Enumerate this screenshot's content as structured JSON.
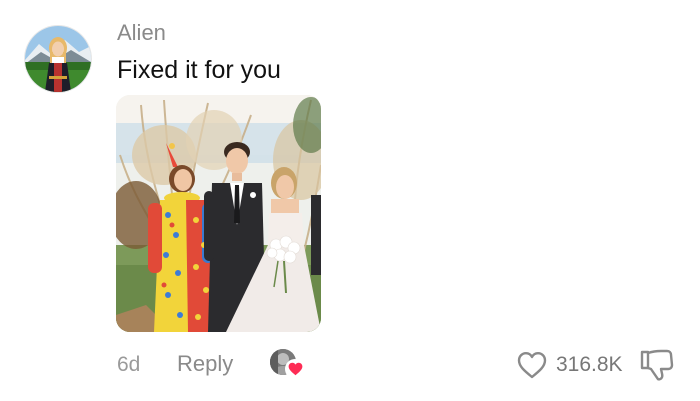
{
  "comment": {
    "username": "Alien",
    "text": "Fixed it for you",
    "age": "6d",
    "reply_label": "Reply",
    "like_count": "316.8K"
  },
  "icons": {
    "avatar": "user-avatar",
    "photo": "attached-photo-wedding-group",
    "liker": "creator-liked-heart-badge",
    "like": "heart-outline-icon",
    "dislike": "thumbs-down-outline-icon"
  },
  "colors": {
    "username": "#8a8a8a",
    "text": "#111111",
    "meta": "#9a9a9a",
    "heart_badge": "#fe2c55"
  }
}
